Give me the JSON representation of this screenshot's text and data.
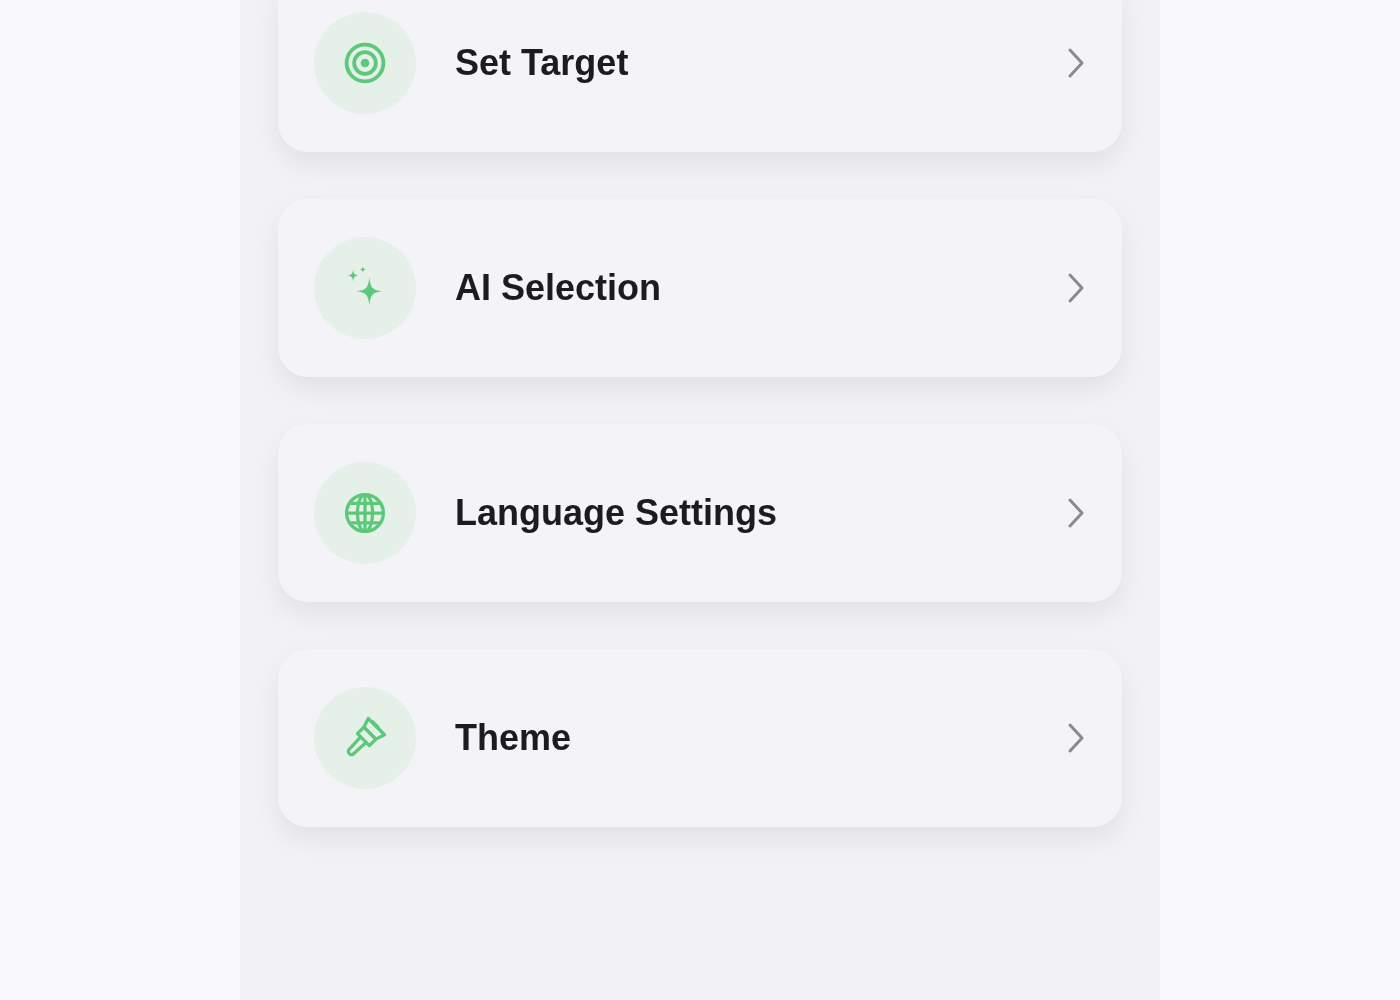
{
  "menu_items": [
    {
      "kind": "target",
      "label": "Set Target"
    },
    {
      "kind": "sparkles",
      "label": "AI Selection"
    },
    {
      "kind": "globe",
      "label": "Language Settings"
    },
    {
      "kind": "brush",
      "label": "Theme"
    }
  ]
}
